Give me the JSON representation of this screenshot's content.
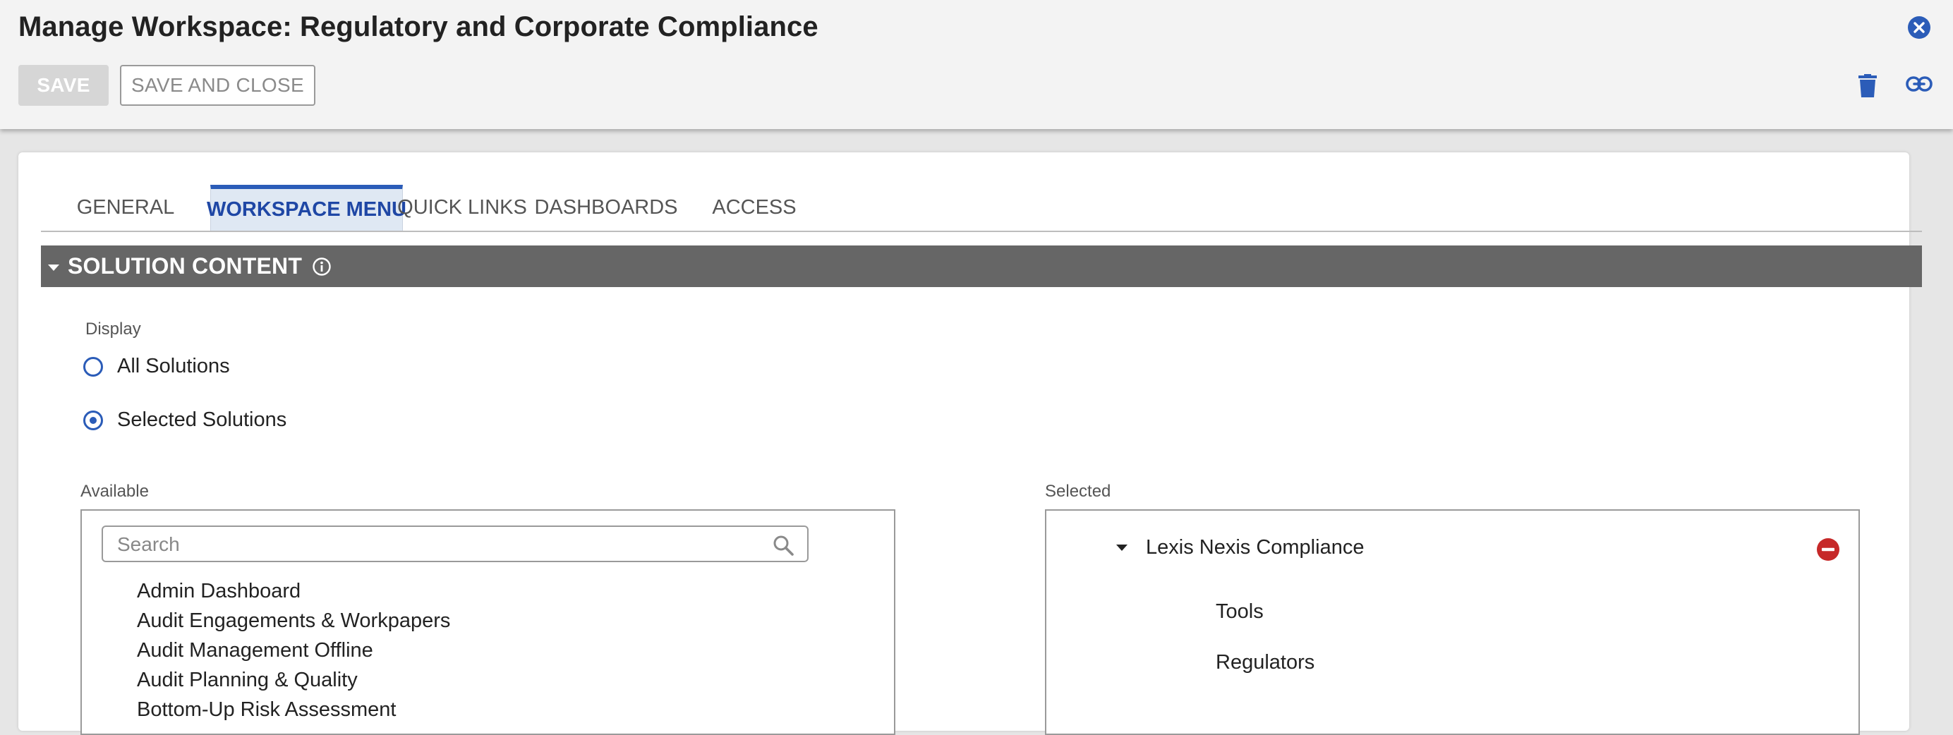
{
  "header": {
    "title": "Manage Workspace: Regulatory and Corporate Compliance",
    "save_label": "SAVE",
    "save_close_label": "SAVE AND CLOSE",
    "icons": {
      "close": "close-circle-icon",
      "delete": "trash-icon",
      "link": "link-icon"
    }
  },
  "tabs": [
    {
      "label": "GENERAL",
      "active": false
    },
    {
      "label": "WORKSPACE MENU",
      "active": true
    },
    {
      "label": "QUICK LINKS",
      "active": false
    },
    {
      "label": "DASHBOARDS",
      "active": false
    },
    {
      "label": "ACCESS",
      "active": false
    }
  ],
  "section": {
    "title": "SOLUTION CONTENT",
    "info_icon": "info-icon"
  },
  "display": {
    "label": "Display",
    "options": [
      {
        "label": "All Solutions",
        "selected": false
      },
      {
        "label": "Selected Solutions",
        "selected": true
      }
    ]
  },
  "available": {
    "label": "Available",
    "search_placeholder": "Search",
    "items": [
      "Admin Dashboard",
      "Audit Engagements & Workpapers",
      "Audit Management Offline",
      "Audit Planning & Quality",
      "Bottom-Up Risk Assessment"
    ]
  },
  "selected": {
    "label": "Selected",
    "root": "Lexis Nexis Compliance",
    "children": [
      "Tools",
      "Regulators"
    ]
  },
  "colors": {
    "accent": "#2b5cb8",
    "remove": "#c62828",
    "section_bar": "#666666"
  }
}
